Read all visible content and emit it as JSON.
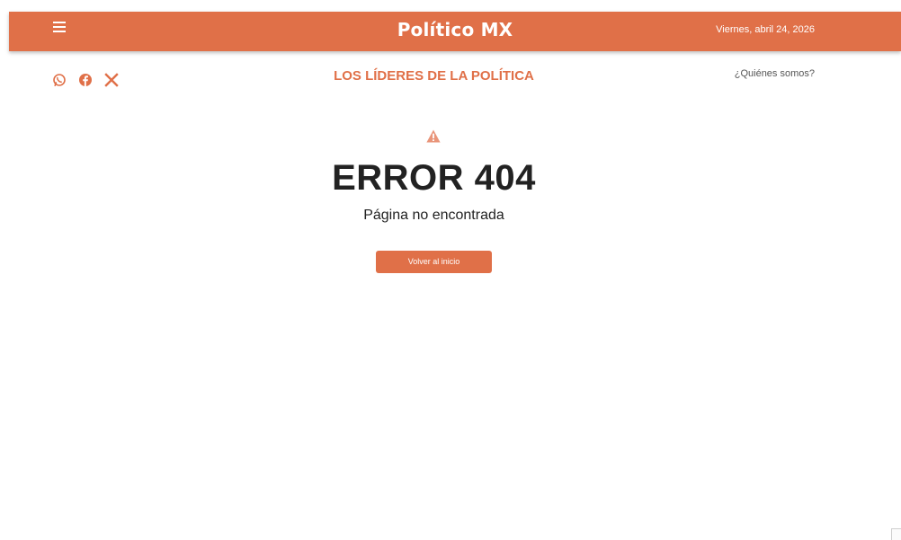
{
  "header": {
    "brand": "Político MX",
    "date": "Viernes, abril 24, 2026",
    "menu_icon": "hamburger-menu-icon"
  },
  "subheader": {
    "social": [
      {
        "name": "whatsapp",
        "icon": "whatsapp-icon"
      },
      {
        "name": "facebook",
        "icon": "facebook-icon"
      },
      {
        "name": "x",
        "icon": "x-twitter-icon"
      }
    ],
    "tagline": "LOS LÍDERES DE LA POLÍTICA",
    "about_link": "¿Quiénes somos?"
  },
  "error": {
    "icon": "warning-icon",
    "title": "ERROR 404",
    "subtitle": "Página no encontrada",
    "home_button": "Volver al inicio"
  },
  "colors": {
    "accent": "#e07048",
    "text_dark": "#222222",
    "text_muted": "#555555"
  }
}
